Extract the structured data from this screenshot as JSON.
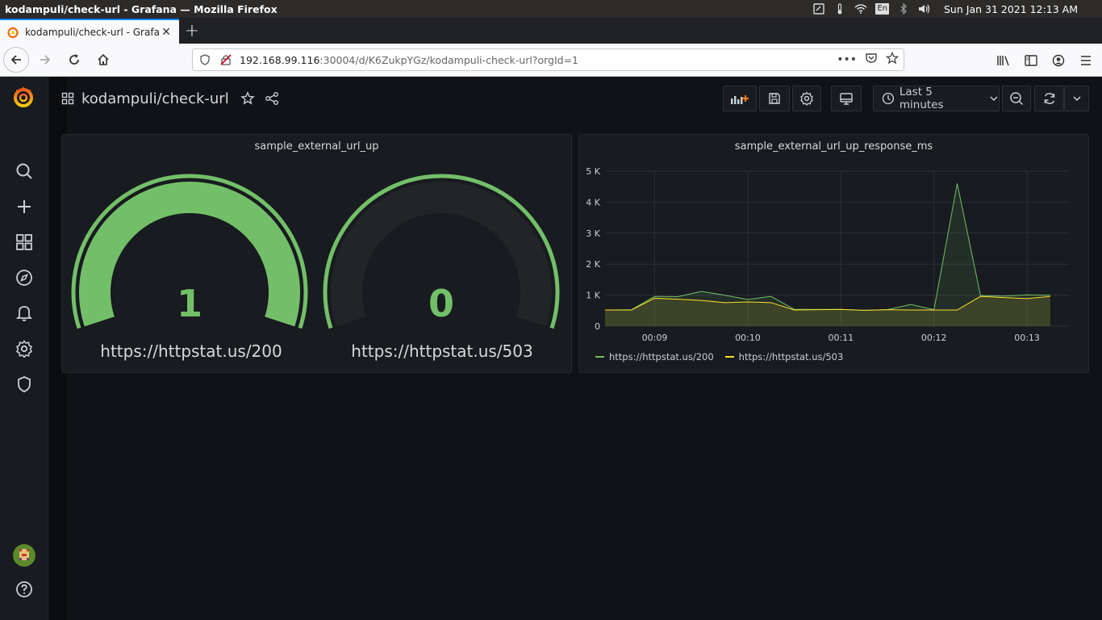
{
  "os": {
    "window_title": "kodampuli/check-url - Grafana — Mozilla Firefox",
    "lang": "En",
    "clock": "Sun Jan 31 2021 12:13 AM"
  },
  "browser": {
    "tab_label": "kodampuli/check-url - Grafana",
    "url_host": "192.168.99.116",
    "url_rest": ":30004/d/K6ZukpYGz/kodampuli-check-url?orgId=1"
  },
  "dashboard": {
    "title": "kodampuli/check-url",
    "time_range": "Last 5 minutes"
  },
  "gauge_panel": {
    "title": "sample_external_url_up",
    "gauges": [
      {
        "value": "1",
        "label": "https://httpstat.us/200",
        "fill_fraction": 1.0
      },
      {
        "value": "0",
        "label": "https://httpstat.us/503",
        "fill_fraction": 0.0
      }
    ]
  },
  "graph_panel": {
    "title": "sample_external_url_up_response_ms"
  },
  "chart_data": {
    "type": "line",
    "title": "sample_external_url_up_response_ms",
    "x_ticks": [
      "00:09",
      "00:10",
      "00:11",
      "00:12",
      "00:13"
    ],
    "y_ticks": [
      "0",
      "1 K",
      "2 K",
      "3 K",
      "4 K",
      "5 K"
    ],
    "ylim": [
      0,
      5000
    ],
    "x": [
      "00:08:28",
      "00:08:45",
      "00:09:00",
      "00:09:15",
      "00:09:30",
      "00:09:45",
      "00:10:00",
      "00:10:15",
      "00:10:30",
      "00:10:45",
      "00:11:00",
      "00:11:15",
      "00:11:30",
      "00:11:45",
      "00:12:00",
      "00:12:15",
      "00:12:30",
      "00:12:45",
      "00:13:00",
      "00:13:15"
    ],
    "xlim": [
      "00:08:28",
      "00:13:27"
    ],
    "series": [
      {
        "name": "https://httpstat.us/200",
        "color": "#73bf69",
        "values": [
          520,
          530,
          960,
          950,
          1120,
          1000,
          860,
          960,
          540,
          540,
          540,
          510,
          530,
          700,
          530,
          4600,
          990,
          970,
          1010,
          1000
        ]
      },
      {
        "name": "https://httpstat.us/503",
        "color": "#fade2a",
        "values": [
          520,
          520,
          900,
          870,
          830,
          760,
          780,
          760,
          520,
          530,
          540,
          510,
          530,
          520,
          520,
          520,
          960,
          920,
          890,
          960
        ]
      }
    ],
    "grid": true,
    "legend": "bottom-left"
  },
  "colors": {
    "accent_green": "#73bf69",
    "accent_yellow": "#fade2a",
    "panel_bg": "#181b1f",
    "page_bg": "#111217"
  }
}
